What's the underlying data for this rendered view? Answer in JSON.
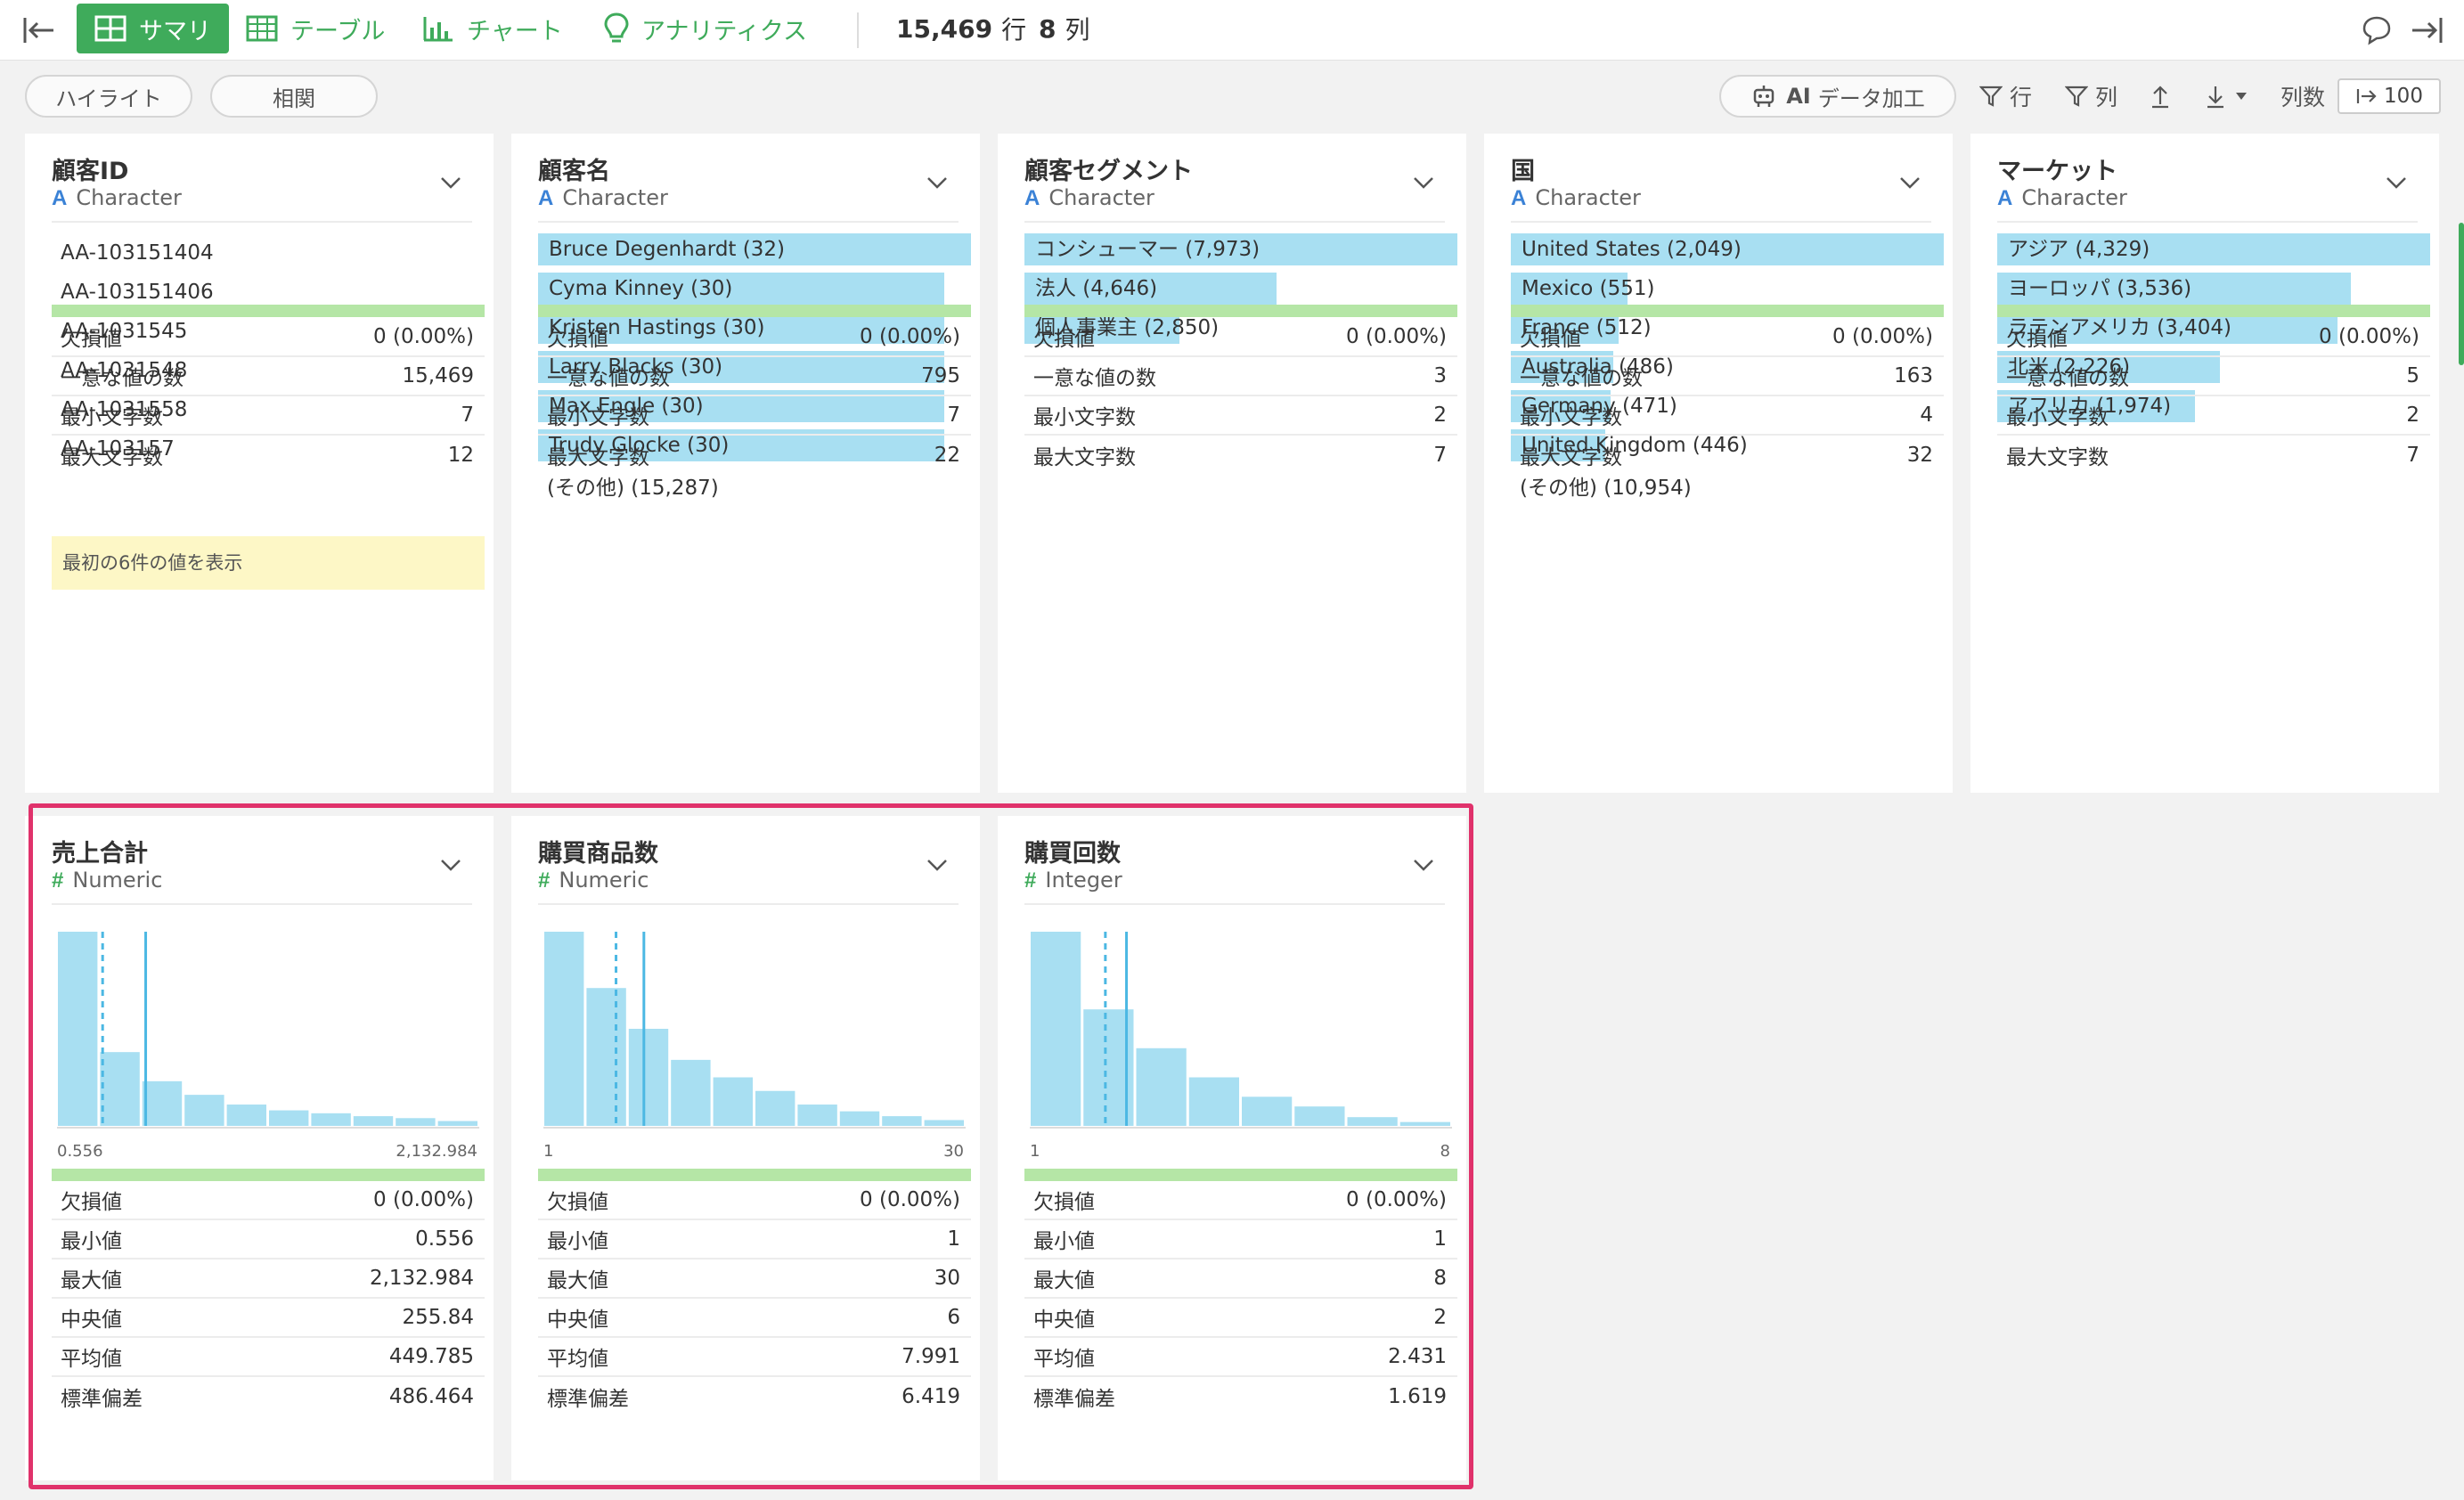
{
  "nav": {
    "tabs": [
      {
        "label": "サマリ",
        "icon": "summary-grid-icon",
        "active": true
      },
      {
        "label": "テーブル",
        "icon": "table-icon",
        "active": false
      },
      {
        "label": "チャート",
        "icon": "bar-chart-icon",
        "active": false
      },
      {
        "label": "アナリティクス",
        "icon": "lightbulb-icon",
        "active": false
      }
    ],
    "rows_count": "15,469",
    "rows_unit": "行",
    "cols_count": "8",
    "cols_unit": "列"
  },
  "toolbar": {
    "highlight": "ハイライト",
    "correlation": "相関",
    "ai_prefix": "AI",
    "ai_label": "データ加工",
    "filter_rows": "行",
    "filter_cols": "列",
    "cols_label": "列数",
    "cols_value": "100"
  },
  "colors": {
    "accent": "#3fab5b",
    "bar": "#a8dff2",
    "highlight": "#e0326b",
    "missing_bar": "#b5e6a6"
  },
  "columns": [
    {
      "name": "顧客ID",
      "type_icon": "A",
      "type": "Character",
      "plain_values": [
        "AA-103151404",
        "AA-103151406",
        "AA-1031545",
        "AA-1031548",
        "AA-1031558",
        "AA-103157"
      ],
      "note": "最初の6件の値を表示",
      "stats": [
        {
          "label": "欠損値",
          "value": "0 (0.00%)"
        },
        {
          "label": "一意な値の数",
          "value": "15,469"
        },
        {
          "label": "最小文字数",
          "value": "7"
        },
        {
          "label": "最大文字数",
          "value": "12"
        }
      ]
    },
    {
      "name": "顧客名",
      "type_icon": "A",
      "type": "Character",
      "bars": [
        {
          "label": "Bruce Degenhardt (32)",
          "value": 32
        },
        {
          "label": "Cyma Kinney (30)",
          "value": 30
        },
        {
          "label": "Kristen Hastings (30)",
          "value": 30
        },
        {
          "label": "Larry Blacks (30)",
          "value": 30
        },
        {
          "label": "Max Engle (30)",
          "value": 30
        },
        {
          "label": "Trudy Glocke (30)",
          "value": 30
        }
      ],
      "bar_max": 32,
      "other": "(その他) (15,287)",
      "stats": [
        {
          "label": "欠損値",
          "value": "0 (0.00%)"
        },
        {
          "label": "一意な値の数",
          "value": "795"
        },
        {
          "label": "最小文字数",
          "value": "7"
        },
        {
          "label": "最大文字数",
          "value": "22"
        }
      ]
    },
    {
      "name": "顧客セグメント",
      "type_icon": "A",
      "type": "Character",
      "bars": [
        {
          "label": "コンシューマー (7,973)",
          "value": 7973
        },
        {
          "label": "法人 (4,646)",
          "value": 4646
        },
        {
          "label": "個人事業主 (2,850)",
          "value": 2850
        }
      ],
      "bar_max": 7973,
      "stats": [
        {
          "label": "欠損値",
          "value": "0 (0.00%)"
        },
        {
          "label": "一意な値の数",
          "value": "3"
        },
        {
          "label": "最小文字数",
          "value": "2"
        },
        {
          "label": "最大文字数",
          "value": "7"
        }
      ]
    },
    {
      "name": "国",
      "type_icon": "A",
      "type": "Character",
      "bars": [
        {
          "label": "United States (2,049)",
          "value": 2049
        },
        {
          "label": "Mexico (551)",
          "value": 551
        },
        {
          "label": "France (512)",
          "value": 512
        },
        {
          "label": "Australia (486)",
          "value": 486
        },
        {
          "label": "Germany (471)",
          "value": 471
        },
        {
          "label": "United Kingdom (446)",
          "value": 446
        }
      ],
      "bar_max": 2049,
      "other": "(その他) (10,954)",
      "stats": [
        {
          "label": "欠損値",
          "value": "0 (0.00%)"
        },
        {
          "label": "一意な値の数",
          "value": "163"
        },
        {
          "label": "最小文字数",
          "value": "4"
        },
        {
          "label": "最大文字数",
          "value": "32"
        }
      ]
    },
    {
      "name": "マーケット",
      "type_icon": "A",
      "type": "Character",
      "bars": [
        {
          "label": "アジア (4,329)",
          "value": 4329
        },
        {
          "label": "ヨーロッパ (3,536)",
          "value": 3536
        },
        {
          "label": "ラテンアメリカ (3,404)",
          "value": 3404
        },
        {
          "label": "北米 (2,226)",
          "value": 2226
        },
        {
          "label": "アフリカ (1,974)",
          "value": 1974
        }
      ],
      "bar_max": 4329,
      "stats": [
        {
          "label": "欠損値",
          "value": "0 (0.00%)"
        },
        {
          "label": "一意な値の数",
          "value": "5"
        },
        {
          "label": "最小文字数",
          "value": "2"
        },
        {
          "label": "最大文字数",
          "value": "7"
        }
      ]
    },
    {
      "name": "売上合計",
      "type_icon": "#",
      "type": "Numeric",
      "hist_bins": [
        100,
        38,
        23,
        16,
        11,
        8,
        6.5,
        5,
        4,
        2.5
      ],
      "median_pos": 0.108,
      "mean_pos": 0.21,
      "axis_min": "0.556",
      "axis_max": "2,132.984",
      "stats": [
        {
          "label": "欠損値",
          "value": "0 (0.00%)"
        },
        {
          "label": "最小値",
          "value": "0.556"
        },
        {
          "label": "最大値",
          "value": "2,132.984"
        },
        {
          "label": "中央値",
          "value": "255.84"
        },
        {
          "label": "平均値",
          "value": "449.785"
        },
        {
          "label": "標準偏差",
          "value": "486.464"
        }
      ]
    },
    {
      "name": "購買商品数",
      "type_icon": "#",
      "type": "Numeric",
      "hist_bins": [
        100,
        71,
        50,
        34,
        25,
        18,
        11,
        7.5,
        5,
        3
      ],
      "median_pos": 0.172,
      "mean_pos": 0.238,
      "axis_min": "1",
      "axis_max": "30",
      "stats": [
        {
          "label": "欠損値",
          "value": "0 (0.00%)"
        },
        {
          "label": "最小値",
          "value": "1"
        },
        {
          "label": "最大値",
          "value": "30"
        },
        {
          "label": "中央値",
          "value": "6"
        },
        {
          "label": "平均値",
          "value": "7.991"
        },
        {
          "label": "標準偏差",
          "value": "6.419"
        }
      ]
    },
    {
      "name": "購買回数",
      "type_icon": "#",
      "type": "Integer",
      "hist_bins": [
        100,
        60,
        40,
        25,
        15,
        10,
        4.5,
        2
      ],
      "median_pos": 0.179,
      "mean_pos": 0.229,
      "axis_min": "1",
      "axis_max": "8",
      "stats": [
        {
          "label": "欠損値",
          "value": "0 (0.00%)"
        },
        {
          "label": "最小値",
          "value": "1"
        },
        {
          "label": "最大値",
          "value": "8"
        },
        {
          "label": "中央値",
          "value": "2"
        },
        {
          "label": "平均値",
          "value": "2.431"
        },
        {
          "label": "標準偏差",
          "value": "1.619"
        }
      ]
    }
  ]
}
